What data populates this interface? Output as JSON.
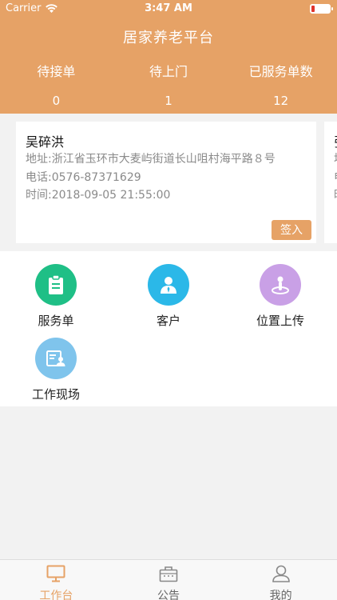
{
  "status_bar": {
    "carrier": "Carrier",
    "time": "3:47 AM"
  },
  "header": {
    "title": "居家养老平台",
    "stats": [
      {
        "label": "待接单",
        "value": "0"
      },
      {
        "label": "待上门",
        "value": "1"
      },
      {
        "label": "已服务单数",
        "value": "12"
      }
    ]
  },
  "cards": [
    {
      "name": "吴碎洪",
      "address": "地址:浙江省玉环市大麦屿街道长山咀村海平路８号",
      "phone": "电话:0576-87371629",
      "time": "时间:2018-09-05  21:55:00",
      "action": "签入"
    },
    {
      "name": "张",
      "address": "地",
      "phone": "电",
      "time": "时"
    }
  ],
  "grid": [
    {
      "label": "服务单",
      "icon": "clipboard-icon",
      "color": "#1fbf86"
    },
    {
      "label": "客户",
      "icon": "user-icon",
      "color": "#2bb8e8"
    },
    {
      "label": "位置上传",
      "icon": "location-icon",
      "color": "#c9a0e6"
    },
    {
      "label": "工作现场",
      "icon": "worksite-icon",
      "color": "#7fc4ec"
    }
  ],
  "tabs": [
    {
      "label": "工作台",
      "icon": "monitor-icon"
    },
    {
      "label": "公告",
      "icon": "bag-icon"
    },
    {
      "label": "我的",
      "icon": "profile-icon"
    }
  ],
  "colors": {
    "accent": "#e6a266",
    "battery_low": "#e0342c"
  }
}
